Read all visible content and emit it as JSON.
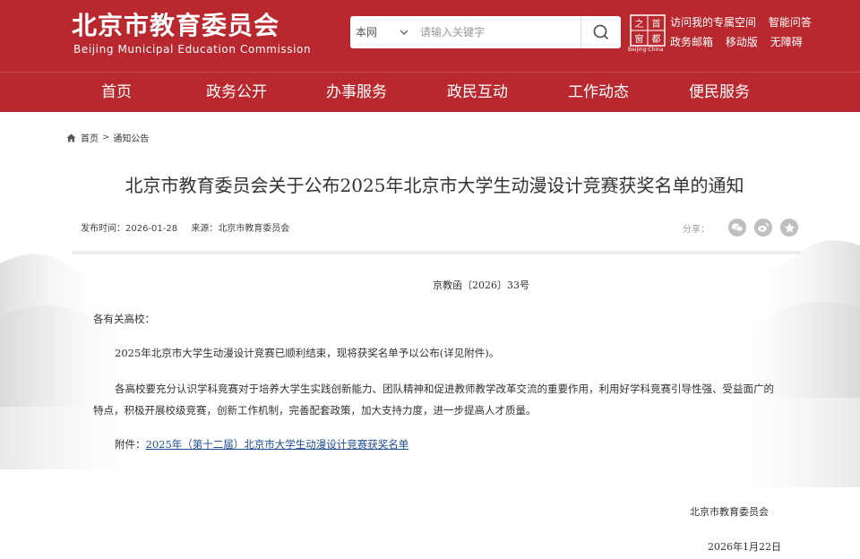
{
  "header": {
    "logo_cn": "北京市教育委员会",
    "logo_en": "Beijing Municipal Education Commission",
    "search": {
      "scope": "本网",
      "placeholder": "请输入关键字"
    },
    "capital_badge": {
      "chars": [
        "首",
        "都",
        "之",
        "窗"
      ],
      "en": "Beijing·China"
    },
    "links_row1": [
      "访问我的专属空间",
      "智能问答"
    ],
    "links_row2": [
      "政务邮箱",
      "移动版",
      "无障碍"
    ]
  },
  "nav": [
    "首页",
    "政务公开",
    "办事服务",
    "政民互动",
    "工作动态",
    "便民服务"
  ],
  "breadcrumb": {
    "home": "首页",
    "separator": ">",
    "current": "通知公告"
  },
  "article": {
    "title": "北京市教育委员会关于公布2025年北京市大学生动漫设计竞赛获奖名单的通知",
    "publish_label": "发布时间：",
    "publish_date": "2026-01-28",
    "source_label": "来源：",
    "source": "北京市教育委员会",
    "share_label": "分享：",
    "doc_number": "京教函〔2026〕33号",
    "salutation": "各有关高校：",
    "paragraph1": "2025年北京市大学生动漫设计竞赛已顺利结束，现将获奖名单予以公布(详见附件)。",
    "paragraph2": "各高校要充分认识学科竞赛对于培养大学生实践创新能力、团队精神和促进教师教学改革交流的重要作用，利用好学科竞赛引导性强、受益面广的特点，积极开展校级竞赛，创新工作机制，完善配套政策，加大支持力度，进一步提高人才质量。",
    "attachment_label": "附件：",
    "attachment_link": "2025年（第十二届）北京市大学生动漫设计竞赛获奖名单",
    "signature": "北京市教育委员会",
    "sign_date": "2026年1月22日"
  },
  "colors": {
    "brand_red": "#b8282e",
    "link_blue": "#1f4e96"
  },
  "icons": [
    "search-icon",
    "chevron-down-icon",
    "home-icon",
    "wechat-icon",
    "weibo-icon",
    "star-icon"
  ]
}
